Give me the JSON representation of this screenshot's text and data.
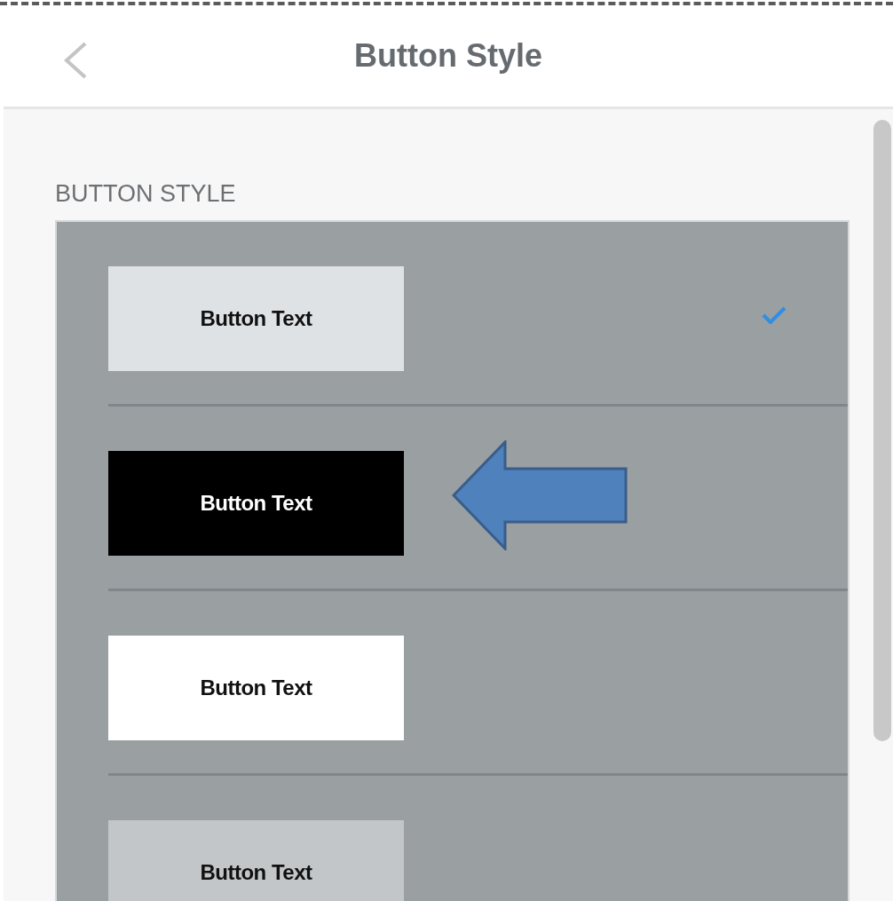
{
  "header": {
    "title": "Button Style"
  },
  "section": {
    "label": "BUTTON STYLE"
  },
  "options": [
    {
      "label": "Button Text",
      "kind": "light",
      "selected": true,
      "annotated": false
    },
    {
      "label": "Button Text",
      "kind": "dark",
      "selected": false,
      "annotated": true
    },
    {
      "label": "Button Text",
      "kind": "white",
      "selected": false,
      "annotated": false
    },
    {
      "label": "Button Text",
      "kind": "grey",
      "selected": false,
      "annotated": false
    }
  ]
}
